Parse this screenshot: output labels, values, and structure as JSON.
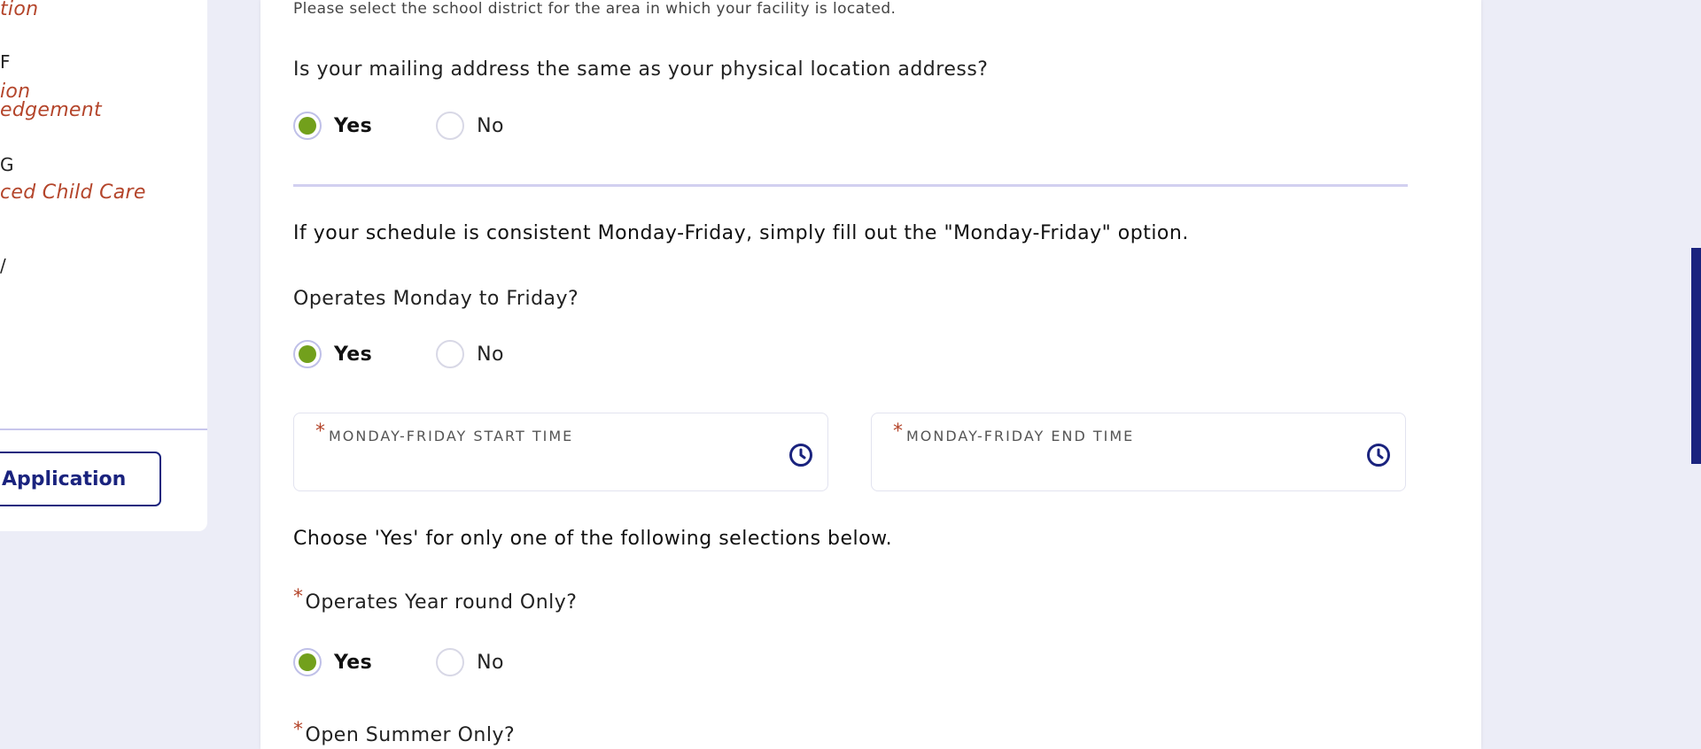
{
  "sidebar": {
    "items": [
      {
        "text": "tion",
        "kind": "link"
      },
      {
        "text": "F",
        "kind": "letter"
      },
      {
        "text": "ion",
        "kind": "link"
      },
      {
        "text": "edgement",
        "kind": "link"
      },
      {
        "text": "G",
        "kind": "letter"
      },
      {
        "text": "ced Child Care",
        "kind": "link"
      },
      {
        "text": "/",
        "kind": "letter"
      }
    ],
    "application_button": "Application"
  },
  "form": {
    "school_district_hint": "Please select the school district for the area in which your facility is located.",
    "mailing_question": "Is your mailing address the same as your physical location address?",
    "mailing_yes": "Yes",
    "mailing_no": "No",
    "mailing_selected": "Yes",
    "schedule_note": "If your schedule is consistent Monday-Friday, simply fill out the \"Monday-Friday\" option.",
    "mon_fri_question": "Operates Monday to Friday?",
    "mon_fri_yes": "Yes",
    "mon_fri_no": "No",
    "mon_fri_selected": "Yes",
    "start_time_label": "MONDAY-FRIDAY START TIME",
    "start_time_value": "",
    "end_time_label": "MONDAY-FRIDAY END TIME",
    "end_time_value": "",
    "choose_note": "Choose 'Yes' for only one of the following selections below.",
    "year_round_question": "Operates Year round Only?",
    "year_round_yes": "Yes",
    "year_round_no": "No",
    "year_round_selected": "Yes",
    "summer_question": "Open Summer Only?",
    "required_mark": "*"
  },
  "colors": {
    "accent_navy": "#1a237e",
    "radio_green": "#72a01c",
    "required_red": "#b4452b",
    "background": "#ecedf7"
  },
  "icons": {
    "clock": "clock-icon"
  }
}
